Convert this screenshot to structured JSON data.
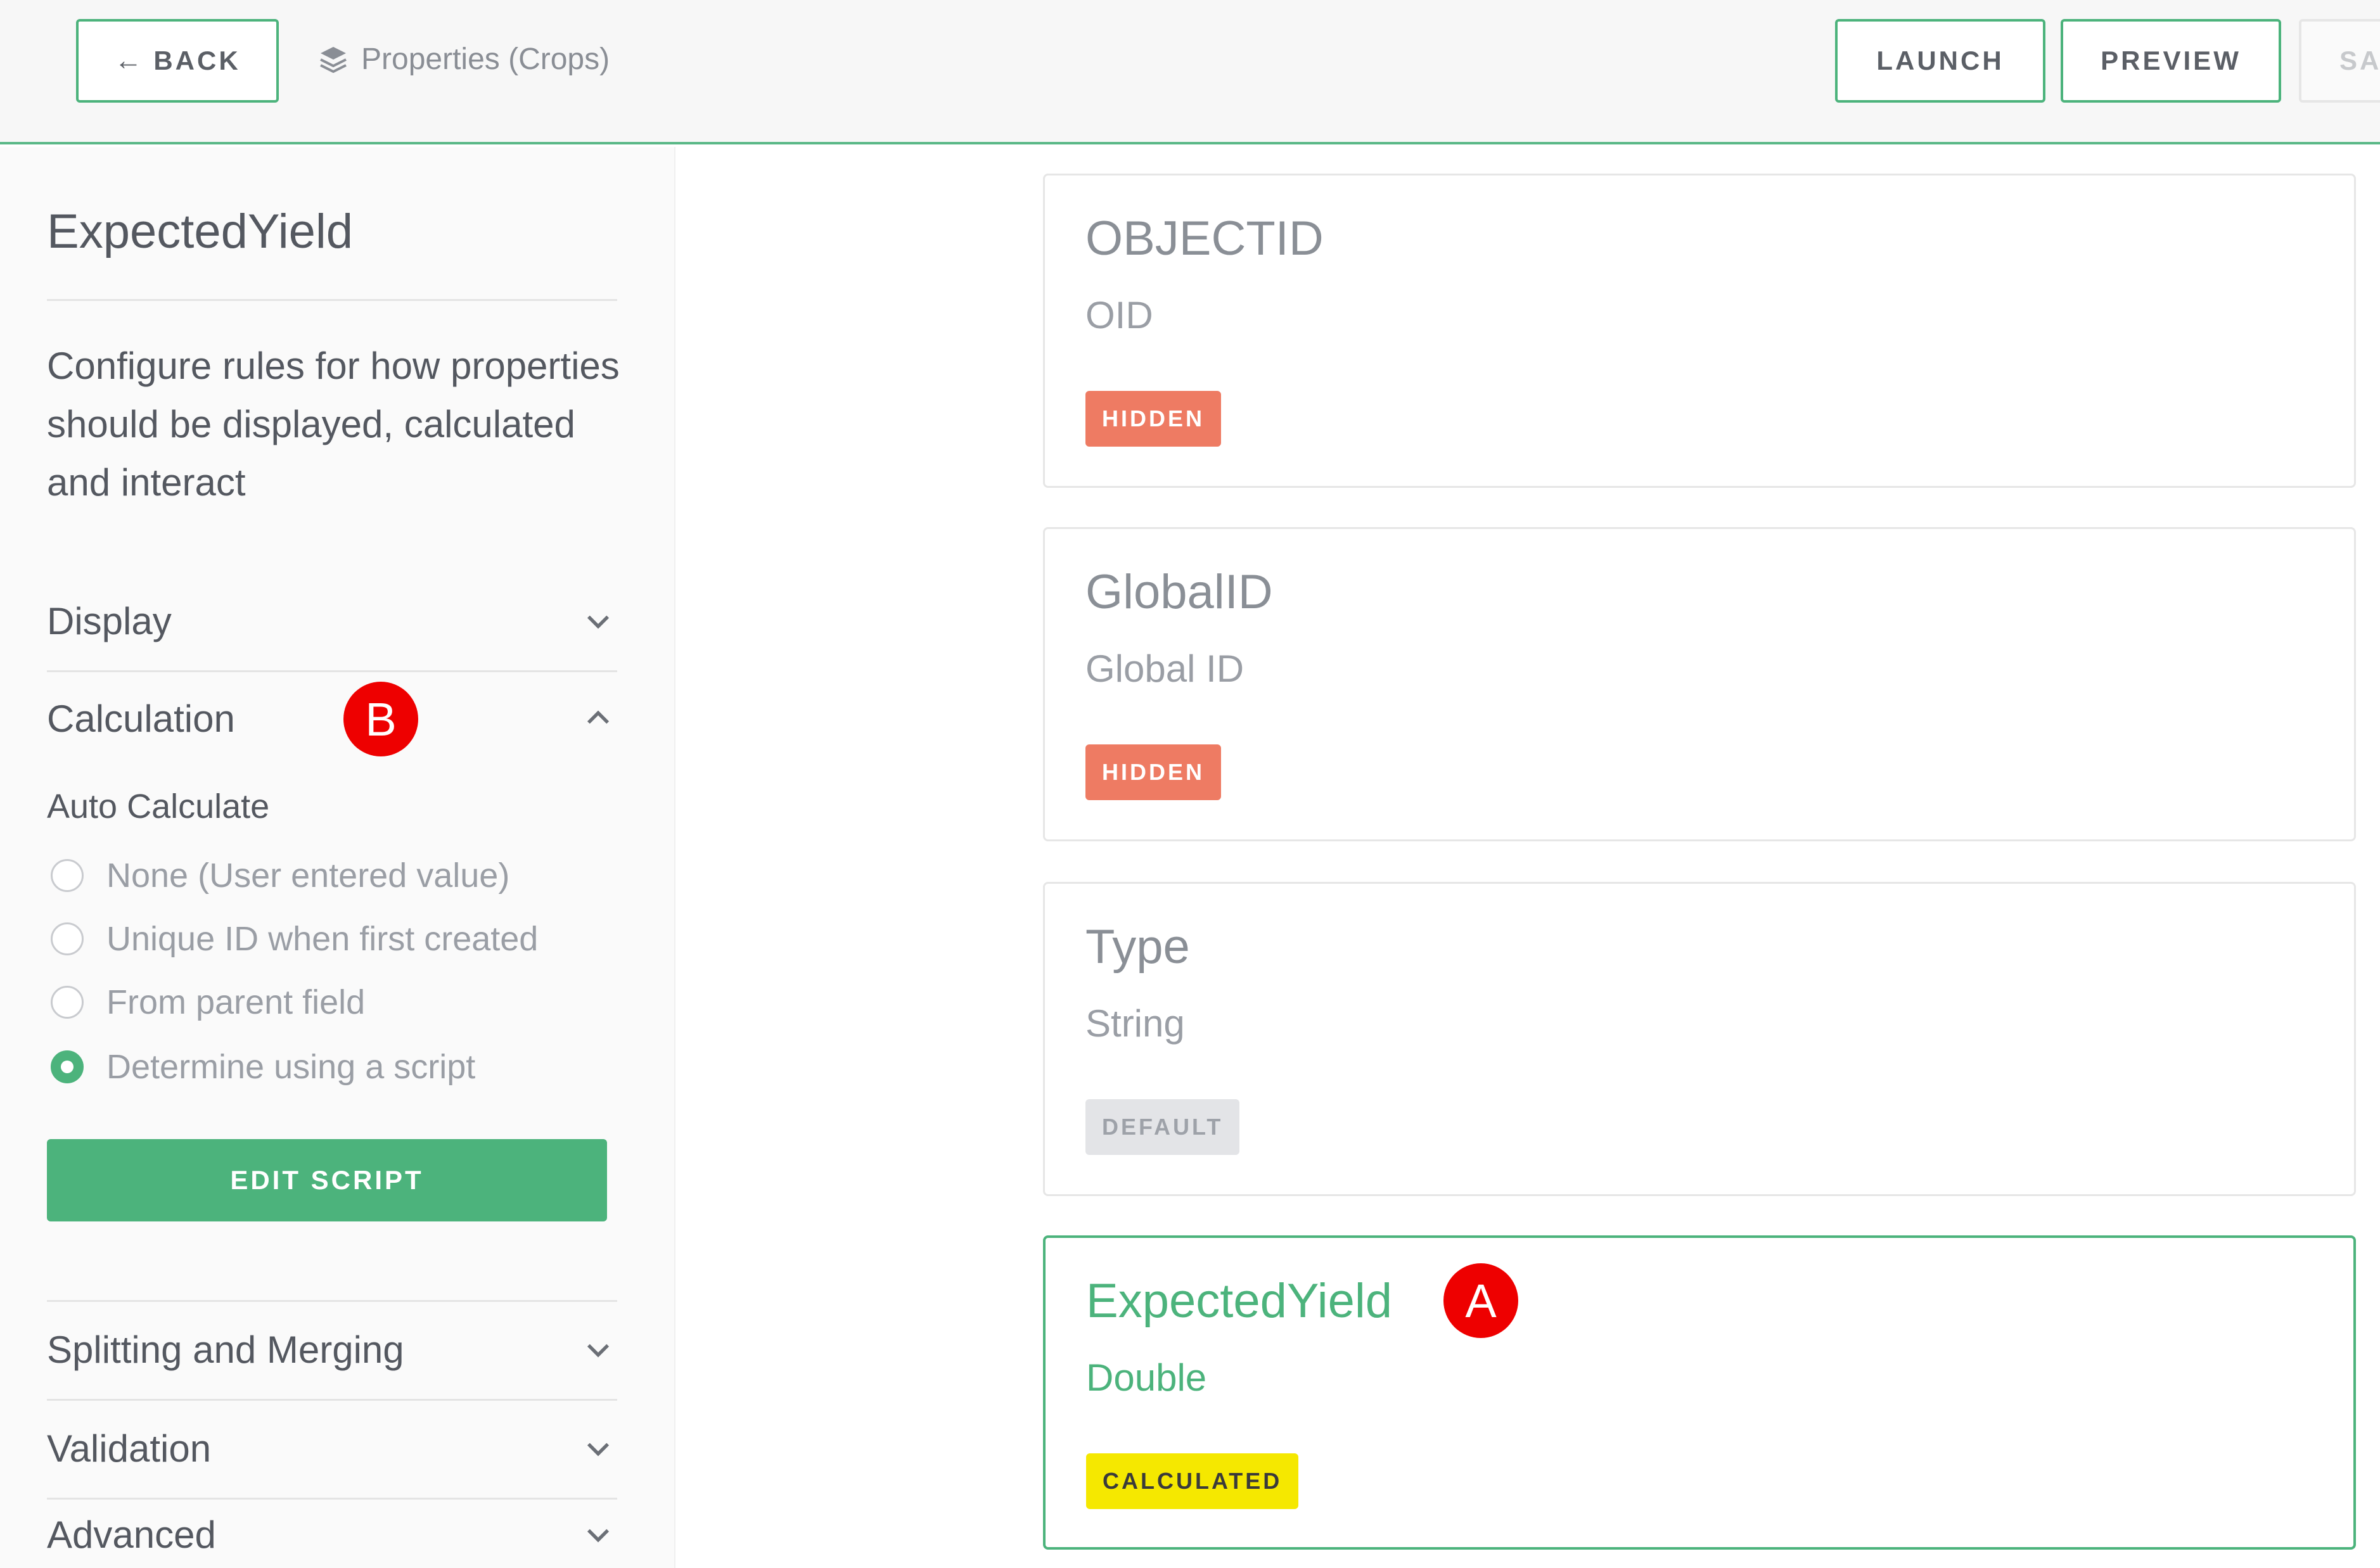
{
  "header": {
    "back_label": "BACK",
    "breadcrumb": "Properties (Crops)",
    "launch_label": "LAUNCH",
    "preview_label": "PREVIEW",
    "save_label": "SA"
  },
  "sidebar": {
    "title": "ExpectedYield",
    "description": "Configure rules for how properties should be displayed, calculated and interact",
    "sections": {
      "display": "Display",
      "calculation": "Calculation",
      "splitting": "Splitting and Merging",
      "validation": "Validation",
      "advanced": "Advanced"
    },
    "auto_calculate": {
      "label": "Auto Calculate",
      "options": [
        "None (User entered value)",
        "Unique ID when first created",
        "From parent field",
        "Determine using a script"
      ],
      "selected_index": 3
    },
    "edit_script_label": "EDIT SCRIPT"
  },
  "fields": [
    {
      "name": "OBJECTID",
      "alias": "OID",
      "badge": "HIDDEN"
    },
    {
      "name": "GlobalID",
      "alias": "Global ID",
      "badge": "HIDDEN"
    },
    {
      "name": "Type",
      "alias": "String",
      "badge": "DEFAULT"
    },
    {
      "name": "ExpectedYield",
      "alias": "Double",
      "badge": "CALCULATED"
    }
  ],
  "markers": {
    "a": "A",
    "b": "B"
  },
  "colors": {
    "accent": "#4cb37c",
    "hidden_badge": "#ee7b63",
    "calculated_badge": "#f5e800",
    "marker": "#ee0000"
  }
}
